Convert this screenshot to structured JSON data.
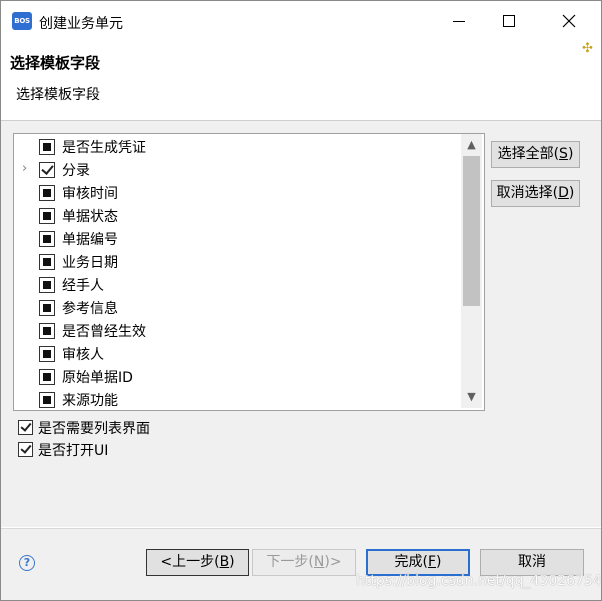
{
  "window": {
    "title": "创建业务单元",
    "app_icon_text": "BOS"
  },
  "header": {
    "title": "选择模板字段",
    "subtitle": "选择模板字段"
  },
  "field_list": {
    "items": [
      {
        "label": "是否生成凭证",
        "state": "indeterminate",
        "expandable": false
      },
      {
        "label": "分录",
        "state": "checked",
        "expandable": true
      },
      {
        "label": "审核时间",
        "state": "indeterminate",
        "expandable": false
      },
      {
        "label": "单据状态",
        "state": "indeterminate",
        "expandable": false
      },
      {
        "label": "单据编号",
        "state": "indeterminate",
        "expandable": false
      },
      {
        "label": "业务日期",
        "state": "indeterminate",
        "expandable": false
      },
      {
        "label": "经手人",
        "state": "indeterminate",
        "expandable": false
      },
      {
        "label": "参考信息",
        "state": "indeterminate",
        "expandable": false
      },
      {
        "label": "是否曾经生效",
        "state": "indeterminate",
        "expandable": false
      },
      {
        "label": "审核人",
        "state": "indeterminate",
        "expandable": false
      },
      {
        "label": "原始单据ID",
        "state": "indeterminate",
        "expandable": false
      },
      {
        "label": "来源功能",
        "state": "indeterminate",
        "expandable": false
      }
    ]
  },
  "side_buttons": {
    "select_all": "选择全部(",
    "select_all_key": "S",
    "deselect": "取消选择(",
    "deselect_key": "D"
  },
  "options": {
    "need_list_ui": {
      "label": "是否需要列表界面",
      "checked": true
    },
    "open_ui": {
      "label": "是否打开UI",
      "checked": true
    }
  },
  "footer": {
    "back": "<上一步(",
    "back_key": "B",
    "next": "下一步(",
    "next_key": "N",
    "next_suffix": ")>",
    "finish": "完成(",
    "finish_key": "F",
    "cancel": "取消",
    "watermark": "https://blog.csdn.net/qq_43026754"
  },
  "colors": {
    "accent": "#2a6fcf",
    "scroll_thumb": "#c2c2c2",
    "body_bg": "#f0f0f0"
  }
}
